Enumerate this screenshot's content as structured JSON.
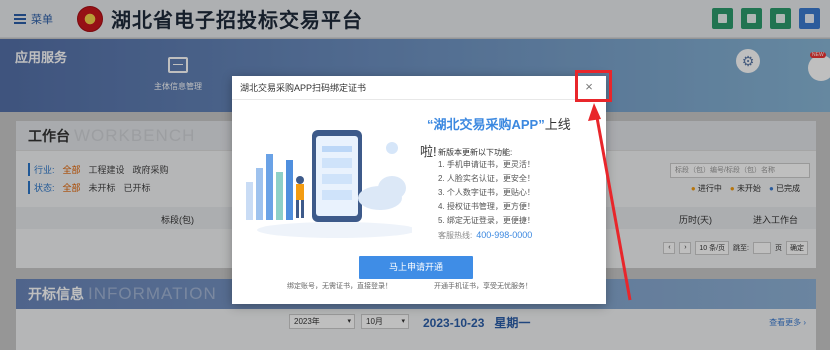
{
  "header": {
    "menu_label": "菜单",
    "site_title": "湖北省电子招投标交易平台",
    "icons": [
      "grid-icon",
      "app-icon",
      "bell-icon",
      "user-icon"
    ]
  },
  "banner": {
    "title": "应用服务",
    "service_label": "主体信息管理",
    "new_badge": "NEW"
  },
  "workbench": {
    "title": "工作台",
    "title_en": "WORKBENCH",
    "industry_label": "行业:",
    "industry_options": [
      "全部",
      "工程建设",
      "政府采购"
    ],
    "status_label": "状态:",
    "status_options": [
      "全部",
      "未开标",
      "已开标"
    ],
    "search_placeholder": "标段（包）编号/标段（包）名称",
    "legend": [
      "进行中",
      "未开始",
      "已完成"
    ],
    "table_headers": [
      "标段(包)",
      "历时(天)",
      "进入工作台"
    ],
    "pager": {
      "per_page": "10 条/页",
      "goto_label": "跳至:",
      "page_unit": "页",
      "confirm": "确定"
    }
  },
  "kaibiao": {
    "title": "开标信息",
    "title_en": "INFORMATION",
    "year": "2023年",
    "month": "10月",
    "date": "2023-10-23",
    "weekday": "星期一",
    "more": "查看更多 ›"
  },
  "modal": {
    "title": "湖北交易采购APP扫码绑定证书",
    "close_symbol": "×",
    "headline_app": "“湖北交易采购APP”",
    "headline_tail": "上线",
    "headline_line2": "啦!",
    "features_title": "新版本更新以下功能:",
    "features": [
      "1. 手机申请证书，更灵活！",
      "2. 人脸实名认证，更安全！",
      "3. 个人数字证书，更贴心！",
      "4. 授权证书管理，更方便！",
      "5. 绑定无证登录，更便捷！"
    ],
    "hotline_label": "客服热线:",
    "hotline_number": "400-998-0000",
    "apply_button": "马上申请开通",
    "caption_left": "绑定账号，无需证书，直接登录！",
    "caption_right": "开通手机证书，享受无忧服务！"
  },
  "colors": {
    "brand_blue": "#3f8de6",
    "annotation_red": "#e8262b"
  }
}
